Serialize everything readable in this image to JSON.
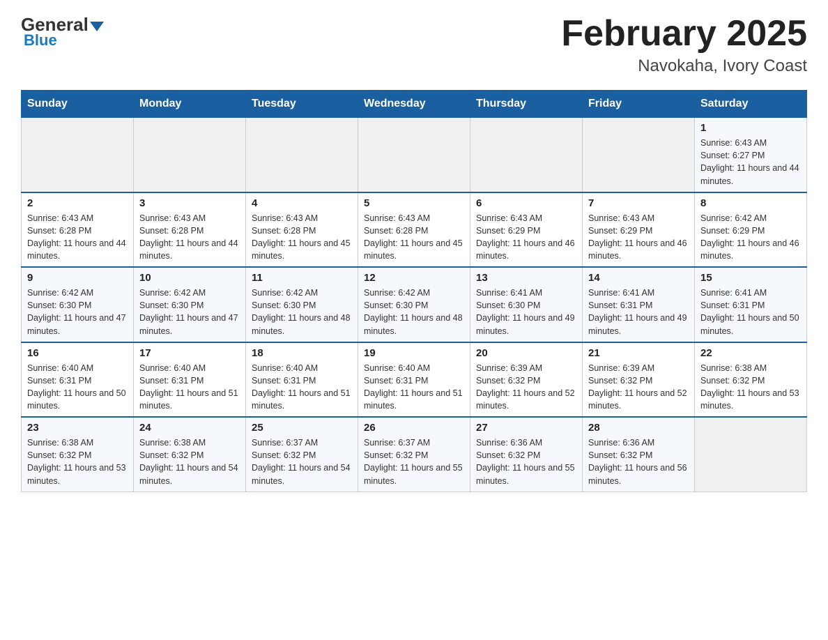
{
  "header": {
    "logo_general": "General",
    "logo_blue": "Blue",
    "month_title": "February 2025",
    "location": "Navokaha, Ivory Coast"
  },
  "weekdays": [
    "Sunday",
    "Monday",
    "Tuesday",
    "Wednesday",
    "Thursday",
    "Friday",
    "Saturday"
  ],
  "weeks": [
    [
      {
        "day": "",
        "sunrise": "",
        "sunset": "",
        "daylight": ""
      },
      {
        "day": "",
        "sunrise": "",
        "sunset": "",
        "daylight": ""
      },
      {
        "day": "",
        "sunrise": "",
        "sunset": "",
        "daylight": ""
      },
      {
        "day": "",
        "sunrise": "",
        "sunset": "",
        "daylight": ""
      },
      {
        "day": "",
        "sunrise": "",
        "sunset": "",
        "daylight": ""
      },
      {
        "day": "",
        "sunrise": "",
        "sunset": "",
        "daylight": ""
      },
      {
        "day": "1",
        "sunrise": "Sunrise: 6:43 AM",
        "sunset": "Sunset: 6:27 PM",
        "daylight": "Daylight: 11 hours and 44 minutes."
      }
    ],
    [
      {
        "day": "2",
        "sunrise": "Sunrise: 6:43 AM",
        "sunset": "Sunset: 6:28 PM",
        "daylight": "Daylight: 11 hours and 44 minutes."
      },
      {
        "day": "3",
        "sunrise": "Sunrise: 6:43 AM",
        "sunset": "Sunset: 6:28 PM",
        "daylight": "Daylight: 11 hours and 44 minutes."
      },
      {
        "day": "4",
        "sunrise": "Sunrise: 6:43 AM",
        "sunset": "Sunset: 6:28 PM",
        "daylight": "Daylight: 11 hours and 45 minutes."
      },
      {
        "day": "5",
        "sunrise": "Sunrise: 6:43 AM",
        "sunset": "Sunset: 6:28 PM",
        "daylight": "Daylight: 11 hours and 45 minutes."
      },
      {
        "day": "6",
        "sunrise": "Sunrise: 6:43 AM",
        "sunset": "Sunset: 6:29 PM",
        "daylight": "Daylight: 11 hours and 46 minutes."
      },
      {
        "day": "7",
        "sunrise": "Sunrise: 6:43 AM",
        "sunset": "Sunset: 6:29 PM",
        "daylight": "Daylight: 11 hours and 46 minutes."
      },
      {
        "day": "8",
        "sunrise": "Sunrise: 6:42 AM",
        "sunset": "Sunset: 6:29 PM",
        "daylight": "Daylight: 11 hours and 46 minutes."
      }
    ],
    [
      {
        "day": "9",
        "sunrise": "Sunrise: 6:42 AM",
        "sunset": "Sunset: 6:30 PM",
        "daylight": "Daylight: 11 hours and 47 minutes."
      },
      {
        "day": "10",
        "sunrise": "Sunrise: 6:42 AM",
        "sunset": "Sunset: 6:30 PM",
        "daylight": "Daylight: 11 hours and 47 minutes."
      },
      {
        "day": "11",
        "sunrise": "Sunrise: 6:42 AM",
        "sunset": "Sunset: 6:30 PM",
        "daylight": "Daylight: 11 hours and 48 minutes."
      },
      {
        "day": "12",
        "sunrise": "Sunrise: 6:42 AM",
        "sunset": "Sunset: 6:30 PM",
        "daylight": "Daylight: 11 hours and 48 minutes."
      },
      {
        "day": "13",
        "sunrise": "Sunrise: 6:41 AM",
        "sunset": "Sunset: 6:30 PM",
        "daylight": "Daylight: 11 hours and 49 minutes."
      },
      {
        "day": "14",
        "sunrise": "Sunrise: 6:41 AM",
        "sunset": "Sunset: 6:31 PM",
        "daylight": "Daylight: 11 hours and 49 minutes."
      },
      {
        "day": "15",
        "sunrise": "Sunrise: 6:41 AM",
        "sunset": "Sunset: 6:31 PM",
        "daylight": "Daylight: 11 hours and 50 minutes."
      }
    ],
    [
      {
        "day": "16",
        "sunrise": "Sunrise: 6:40 AM",
        "sunset": "Sunset: 6:31 PM",
        "daylight": "Daylight: 11 hours and 50 minutes."
      },
      {
        "day": "17",
        "sunrise": "Sunrise: 6:40 AM",
        "sunset": "Sunset: 6:31 PM",
        "daylight": "Daylight: 11 hours and 51 minutes."
      },
      {
        "day": "18",
        "sunrise": "Sunrise: 6:40 AM",
        "sunset": "Sunset: 6:31 PM",
        "daylight": "Daylight: 11 hours and 51 minutes."
      },
      {
        "day": "19",
        "sunrise": "Sunrise: 6:40 AM",
        "sunset": "Sunset: 6:31 PM",
        "daylight": "Daylight: 11 hours and 51 minutes."
      },
      {
        "day": "20",
        "sunrise": "Sunrise: 6:39 AM",
        "sunset": "Sunset: 6:32 PM",
        "daylight": "Daylight: 11 hours and 52 minutes."
      },
      {
        "day": "21",
        "sunrise": "Sunrise: 6:39 AM",
        "sunset": "Sunset: 6:32 PM",
        "daylight": "Daylight: 11 hours and 52 minutes."
      },
      {
        "day": "22",
        "sunrise": "Sunrise: 6:38 AM",
        "sunset": "Sunset: 6:32 PM",
        "daylight": "Daylight: 11 hours and 53 minutes."
      }
    ],
    [
      {
        "day": "23",
        "sunrise": "Sunrise: 6:38 AM",
        "sunset": "Sunset: 6:32 PM",
        "daylight": "Daylight: 11 hours and 53 minutes."
      },
      {
        "day": "24",
        "sunrise": "Sunrise: 6:38 AM",
        "sunset": "Sunset: 6:32 PM",
        "daylight": "Daylight: 11 hours and 54 minutes."
      },
      {
        "day": "25",
        "sunrise": "Sunrise: 6:37 AM",
        "sunset": "Sunset: 6:32 PM",
        "daylight": "Daylight: 11 hours and 54 minutes."
      },
      {
        "day": "26",
        "sunrise": "Sunrise: 6:37 AM",
        "sunset": "Sunset: 6:32 PM",
        "daylight": "Daylight: 11 hours and 55 minutes."
      },
      {
        "day": "27",
        "sunrise": "Sunrise: 6:36 AM",
        "sunset": "Sunset: 6:32 PM",
        "daylight": "Daylight: 11 hours and 55 minutes."
      },
      {
        "day": "28",
        "sunrise": "Sunrise: 6:36 AM",
        "sunset": "Sunset: 6:32 PM",
        "daylight": "Daylight: 11 hours and 56 minutes."
      },
      {
        "day": "",
        "sunrise": "",
        "sunset": "",
        "daylight": ""
      }
    ]
  ]
}
